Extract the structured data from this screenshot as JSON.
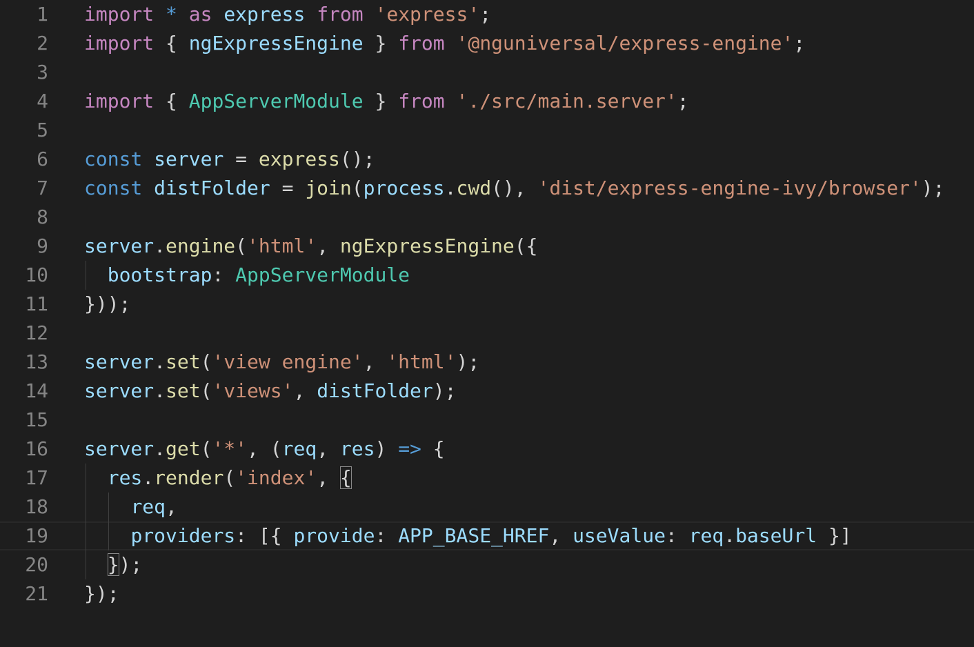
{
  "colors": {
    "background": "#1e1e1e",
    "line_number": "#858585",
    "keyword_control": "#c586c0",
    "keyword_storage": "#569cd6",
    "variable": "#9cdcfe",
    "function": "#dcdcaa",
    "string": "#ce9178",
    "type": "#4ec9b0",
    "punctuation": "#d4d4d4",
    "constant": "#4fc1ff"
  },
  "editor": {
    "current_line": 19,
    "lines": [
      {
        "n": "1",
        "tokens": [
          {
            "t": "import",
            "c": "keyword_control"
          },
          {
            "t": " "
          },
          {
            "t": "*",
            "c": "keyword_storage"
          },
          {
            "t": " "
          },
          {
            "t": "as",
            "c": "keyword_control"
          },
          {
            "t": " "
          },
          {
            "t": "express",
            "c": "variable"
          },
          {
            "t": " "
          },
          {
            "t": "from",
            "c": "keyword_control"
          },
          {
            "t": " "
          },
          {
            "t": "'express'",
            "c": "string"
          },
          {
            "t": ";"
          }
        ]
      },
      {
        "n": "2",
        "tokens": [
          {
            "t": "import",
            "c": "keyword_control"
          },
          {
            "t": " { "
          },
          {
            "t": "ngExpressEngine",
            "c": "variable"
          },
          {
            "t": " } "
          },
          {
            "t": "from",
            "c": "keyword_control"
          },
          {
            "t": " "
          },
          {
            "t": "'@nguniversal/express-engine'",
            "c": "string"
          },
          {
            "t": ";"
          }
        ]
      },
      {
        "n": "3",
        "tokens": []
      },
      {
        "n": "4",
        "tokens": [
          {
            "t": "import",
            "c": "keyword_control"
          },
          {
            "t": " { "
          },
          {
            "t": "AppServerModule",
            "c": "type"
          },
          {
            "t": " } "
          },
          {
            "t": "from",
            "c": "keyword_control"
          },
          {
            "t": " "
          },
          {
            "t": "'./src/main.server'",
            "c": "string"
          },
          {
            "t": ";"
          }
        ]
      },
      {
        "n": "5",
        "tokens": []
      },
      {
        "n": "6",
        "tokens": [
          {
            "t": "const",
            "c": "keyword_storage"
          },
          {
            "t": " "
          },
          {
            "t": "server",
            "c": "variable"
          },
          {
            "t": " = "
          },
          {
            "t": "express",
            "c": "function"
          },
          {
            "t": "();"
          }
        ]
      },
      {
        "n": "7",
        "tokens": [
          {
            "t": "const",
            "c": "keyword_storage"
          },
          {
            "t": " "
          },
          {
            "t": "distFolder",
            "c": "variable"
          },
          {
            "t": " = "
          },
          {
            "t": "join",
            "c": "function"
          },
          {
            "t": "("
          },
          {
            "t": "process",
            "c": "variable"
          },
          {
            "t": "."
          },
          {
            "t": "cwd",
            "c": "function"
          },
          {
            "t": "(), "
          },
          {
            "t": "'dist/express-engine-ivy/browser'",
            "c": "string"
          },
          {
            "t": ");"
          }
        ]
      },
      {
        "n": "8",
        "tokens": []
      },
      {
        "n": "9",
        "tokens": [
          {
            "t": "server",
            "c": "variable"
          },
          {
            "t": "."
          },
          {
            "t": "engine",
            "c": "function"
          },
          {
            "t": "("
          },
          {
            "t": "'html'",
            "c": "string"
          },
          {
            "t": ", "
          },
          {
            "t": "ngExpressEngine",
            "c": "function"
          },
          {
            "t": "({"
          }
        ]
      },
      {
        "n": "10",
        "tokens": [
          {
            "t": "  "
          },
          {
            "t": "bootstrap",
            "c": "variable"
          },
          {
            "t": ": "
          },
          {
            "t": "AppServerModule",
            "c": "type"
          }
        ]
      },
      {
        "n": "11",
        "tokens": [
          {
            "t": "}));"
          }
        ]
      },
      {
        "n": "12",
        "tokens": []
      },
      {
        "n": "13",
        "tokens": [
          {
            "t": "server",
            "c": "variable"
          },
          {
            "t": "."
          },
          {
            "t": "set",
            "c": "function"
          },
          {
            "t": "("
          },
          {
            "t": "'view engine'",
            "c": "string"
          },
          {
            "t": ", "
          },
          {
            "t": "'html'",
            "c": "string"
          },
          {
            "t": ");"
          }
        ]
      },
      {
        "n": "14",
        "tokens": [
          {
            "t": "server",
            "c": "variable"
          },
          {
            "t": "."
          },
          {
            "t": "set",
            "c": "function"
          },
          {
            "t": "("
          },
          {
            "t": "'views'",
            "c": "string"
          },
          {
            "t": ", "
          },
          {
            "t": "distFolder",
            "c": "variable"
          },
          {
            "t": ");"
          }
        ]
      },
      {
        "n": "15",
        "tokens": []
      },
      {
        "n": "16",
        "tokens": [
          {
            "t": "server",
            "c": "variable"
          },
          {
            "t": "."
          },
          {
            "t": "get",
            "c": "function"
          },
          {
            "t": "("
          },
          {
            "t": "'*'",
            "c": "string"
          },
          {
            "t": ", ("
          },
          {
            "t": "req",
            "c": "variable"
          },
          {
            "t": ", "
          },
          {
            "t": "res",
            "c": "variable"
          },
          {
            "t": ") "
          },
          {
            "t": "=>",
            "c": "keyword_storage"
          },
          {
            "t": " {"
          }
        ]
      },
      {
        "n": "17",
        "tokens": [
          {
            "t": "  "
          },
          {
            "t": "res",
            "c": "variable"
          },
          {
            "t": "."
          },
          {
            "t": "render",
            "c": "function"
          },
          {
            "t": "("
          },
          {
            "t": "'index'",
            "c": "string"
          },
          {
            "t": ", "
          },
          {
            "t": "{",
            "box": true
          }
        ]
      },
      {
        "n": "18",
        "tokens": [
          {
            "t": "    "
          },
          {
            "t": "req",
            "c": "variable"
          },
          {
            "t": ","
          }
        ]
      },
      {
        "n": "19",
        "tokens": [
          {
            "t": "    "
          },
          {
            "t": "providers",
            "c": "variable"
          },
          {
            "t": ": [{ "
          },
          {
            "t": "provide",
            "c": "variable"
          },
          {
            "t": ": "
          },
          {
            "t": "APP_BASE_HREF",
            "c": "variable"
          },
          {
            "t": ", "
          },
          {
            "t": "useValue",
            "c": "variable"
          },
          {
            "t": ": "
          },
          {
            "t": "req",
            "c": "variable"
          },
          {
            "t": "."
          },
          {
            "t": "baseUrl",
            "c": "variable"
          },
          {
            "t": " }]"
          }
        ]
      },
      {
        "n": "20",
        "tokens": [
          {
            "t": "  "
          },
          {
            "t": "}",
            "box": true
          },
          {
            "t": ");"
          }
        ]
      },
      {
        "n": "21",
        "tokens": [
          {
            "t": "});"
          }
        ]
      }
    ]
  }
}
